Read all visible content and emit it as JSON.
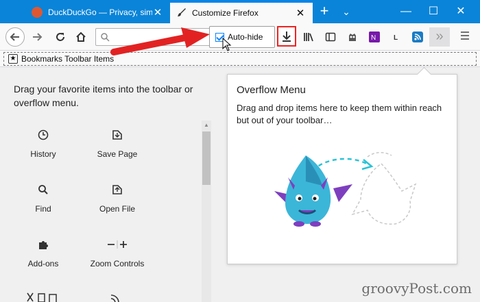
{
  "tabs": [
    {
      "title": "DuckDuckGo — Privacy, simplified.",
      "favicon_color": "#de5833",
      "active": false
    },
    {
      "title": "Customize Firefox",
      "active": true
    }
  ],
  "window": {
    "minimize": "—",
    "maximize": "☐",
    "close": "✕"
  },
  "toolbar": {
    "autohide_label": "Auto-hide",
    "autohide_checked": true
  },
  "bookmarks": {
    "label": "Bookmarks Toolbar Items"
  },
  "palette": {
    "intro": "Drag your favorite items into the toolbar or overflow menu.",
    "items": [
      {
        "label": "History",
        "icon": "clock-icon"
      },
      {
        "label": "Save Page",
        "icon": "save-page-icon"
      },
      {
        "label": "Find",
        "icon": "magnifier-icon"
      },
      {
        "label": "Open File",
        "icon": "open-file-icon"
      },
      {
        "label": "Add-ons",
        "icon": "puzzle-icon"
      },
      {
        "label": "Zoom Controls",
        "icon": "zoom-icon"
      }
    ]
  },
  "overflow": {
    "title": "Overflow Menu",
    "description": "Drag and drop items here to keep them within reach but out of your toolbar…"
  },
  "watermark": "groovyPost.com",
  "colors": {
    "accent": "#0a84ff",
    "tabstrip": "#0a84d8",
    "highlight": "#e22222"
  }
}
